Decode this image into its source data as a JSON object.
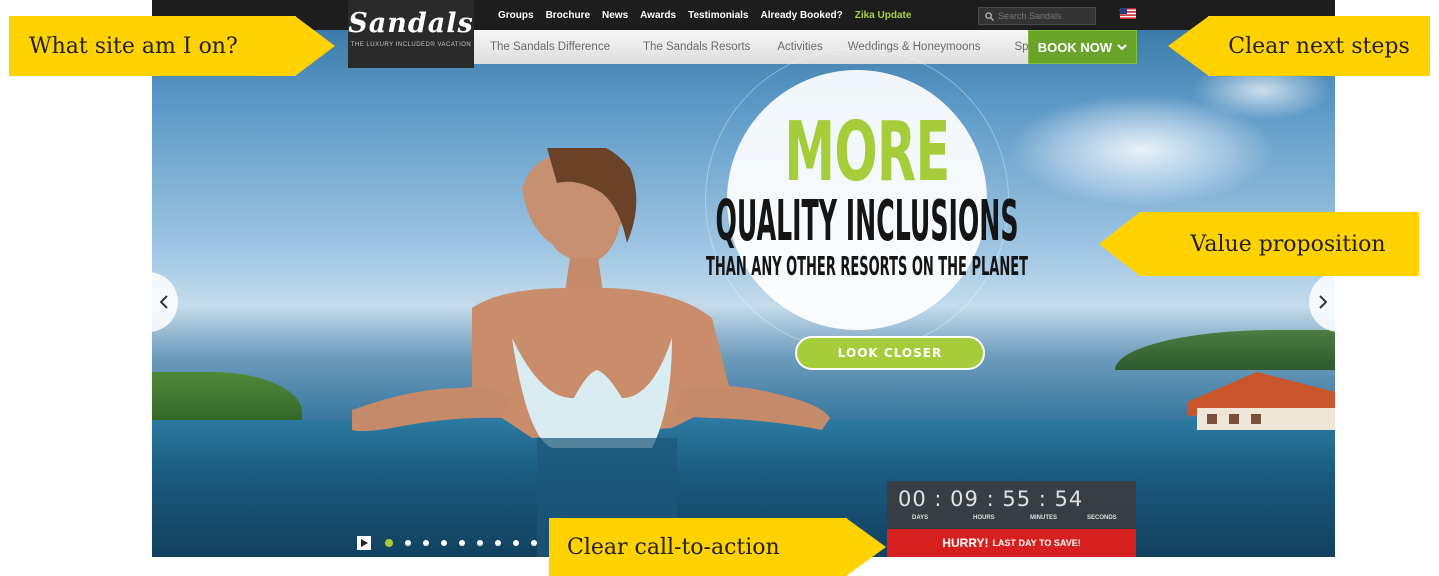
{
  "site": {
    "logo_text": "Sandals",
    "logo_tagline": "THE LUXURY INCLUDED® VACATION"
  },
  "utility_nav": [
    "Groups",
    "Brochure",
    "News",
    "Awards",
    "Testimonials",
    "Already Booked?",
    "Zika Update"
  ],
  "search": {
    "placeholder": "Search Sandals"
  },
  "locale_flag_icon": "us-flag-icon",
  "main_nav": [
    "The Sandals Difference",
    "The Sandals Resorts",
    "Activities",
    "Weddings & Honeymoons",
    "Specials"
  ],
  "book_now": {
    "label": "BOOK NOW",
    "icon": "chevron-down-icon"
  },
  "hero": {
    "headline": "MORE",
    "subheadline": "QUALITY INCLUSIONS",
    "tagline": "THAN ANY OTHER RESORTS ON THE PLANET",
    "cta_label": "LOOK CLOSER"
  },
  "carousel": {
    "prev_icon": "chevron-left-icon",
    "next_icon": "chevron-right-icon",
    "play_icon": "play-icon",
    "slide_count": 11,
    "active_slide": 1
  },
  "countdown": {
    "days": "00",
    "hours": "09",
    "minutes": "55",
    "seconds": "54",
    "labels": {
      "days": "DAYS",
      "hours": "HOURS",
      "minutes": "MINUTES",
      "seconds": "SECONDS"
    },
    "banner_strong": "HURRY!",
    "banner_sub": "LAST DAY TO SAVE!"
  },
  "callouts": {
    "site": "What site am I on?",
    "next_steps": "Clear next steps",
    "value_prop": "Value proposition",
    "cta": "Clear call-to-action"
  },
  "colors": {
    "brand_green": "#a4cd39",
    "book_green": "#6aa32a",
    "callout_yellow": "#ffd200",
    "hurry_red": "#d6201f",
    "top_bar": "#1d1d1d"
  }
}
